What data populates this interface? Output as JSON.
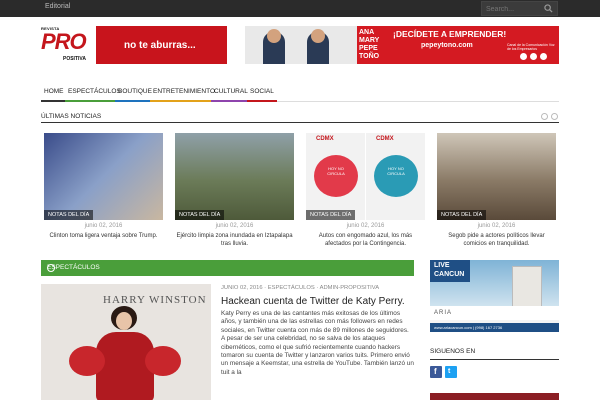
{
  "topbar": {
    "editorial": "Editorial",
    "search_placeholder": "Search..."
  },
  "logo": {
    "revista": "REVISTA",
    "pro": "PRO",
    "positiva": "POSITIVA",
    "banner_text": "no te aburras..."
  },
  "ad": {
    "pepe_text": "ANA MARY PEPE TOÑO",
    "headline": "¡DECÍDETE A EMPRENDER!",
    "url": "pepeytono.com",
    "small": "Canal de la Comunicación Voz de los Empresarios"
  },
  "nav": [
    {
      "label": "HOME",
      "color": "#333333"
    },
    {
      "label": "ESPECTÁCULOS",
      "color": "#4a9e3a"
    },
    {
      "label": "BOUTIQUE",
      "color": "#1e73be"
    },
    {
      "label": "ENTRETENIMIENTO",
      "color": "#e3a21a"
    },
    {
      "label": "CULTURAL",
      "color": "#8e44ad"
    },
    {
      "label": "SOCIAL",
      "color": "#c4161c"
    }
  ],
  "ultimas": {
    "title": "ÚLTIMAS NOTICIAS"
  },
  "cards": [
    {
      "tag": "NOTAS DEL DÍA",
      "date": "junio 02, 2016",
      "caption": "Clinton toma ligera ventaja sobre Trump."
    },
    {
      "tag": "NOTAS DEL DÍA",
      "date": "junio 02, 2016",
      "caption": "Ejército limpia zona inundada en Iztapalapa tras lluvia."
    },
    {
      "tag": "NOTAS DEL DÍA",
      "date": "junio 02, 2016",
      "caption": "Autos con engomado azul, los más afectados por la Contingencia."
    },
    {
      "tag": "NOTAS DEL DÍA",
      "date": "junio 02, 2016",
      "caption": "Segob pide a actores políticos llevar comicios en tranquilidad."
    }
  ],
  "cdmx": {
    "label": "CDMX",
    "hoy": "HOY NO CIRCULA"
  },
  "espectaculos": {
    "title": "ESPECTÁCULOS",
    "meta": "JUNIO 02, 2016 · ESPECTÁCULOS · ADMIN-PROPOSITIVA",
    "headline": "Hackean cuenta de Twitter de Katy Perry.",
    "body": "Katy Perry es una de las cantantes más exitosas de los últimos años, y también una de las estrellas con más followers en redes sociales, en Twitter cuenta con más de 89 millones de seguidores. A pesar de ser una celebridad, no se salva de los ataques cibernéticos, como el que sufrió recientemente cuando hackers tomaron su cuenta de Twitter y lanzaron varios tuits. Primero envió un mensaje a Keemstar, una estrella de YouTube. También lanzó un tuit a la",
    "backdrop": "HARRY WINSTON"
  },
  "side_ad": {
    "live": "LIVE",
    "cancun": "CANCUN",
    "aria": "ARIA",
    "footer": "www.ariacancun.com | (998) 167 2736"
  },
  "siguenos": {
    "title": "SIGUENOS EN"
  }
}
